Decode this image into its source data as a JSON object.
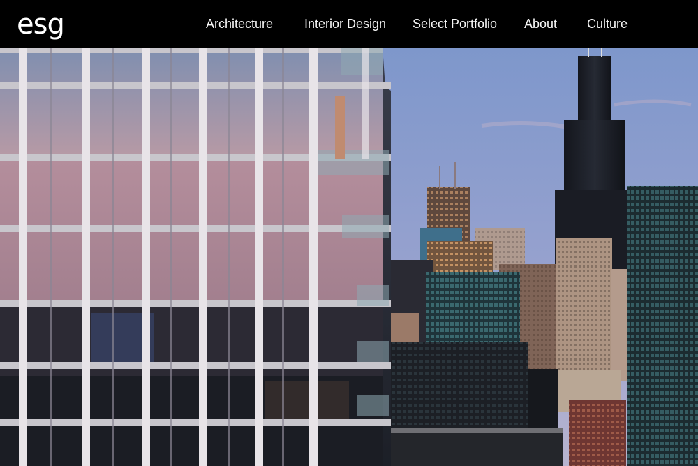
{
  "brand": {
    "logo_text": "esg"
  },
  "nav": {
    "items": [
      {
        "label": "Architecture"
      },
      {
        "label": "Interior Design"
      },
      {
        "label": "Select Portfolio"
      },
      {
        "label": "About"
      },
      {
        "label": "Culture"
      }
    ]
  },
  "colors": {
    "header_bg": "#000000",
    "header_text": "#ffffff",
    "sky_top": "#7f95c8",
    "sky_bottom": "#b7b8d3"
  }
}
